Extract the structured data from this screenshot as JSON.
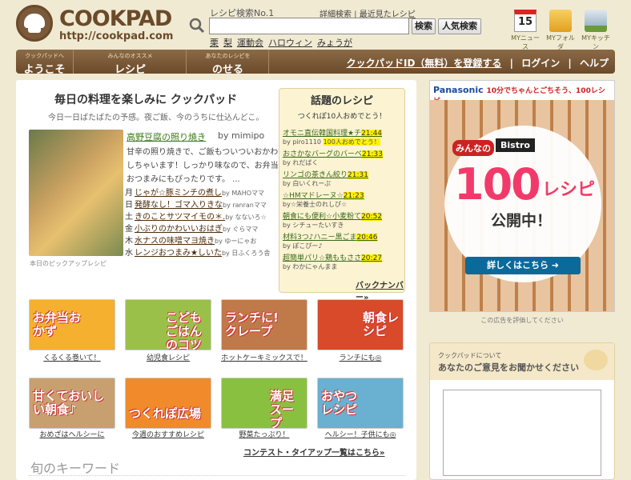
{
  "header": {
    "logo_name": "COOKPAD",
    "logo_url": "http://cookpad.com",
    "search_title": "レシピ検索No.1",
    "link_detail": "詳細検索",
    "link_recent": "最近見たレシピ",
    "search_button": "検索",
    "popular_button": "人気検索",
    "keywords": [
      "栗",
      "梨",
      "運動会",
      "ハロウィン",
      "みょうが"
    ],
    "my_icons": [
      {
        "label": "MYニュース",
        "icon": "calendar-icon",
        "num": "15"
      },
      {
        "label": "MYフォルダ",
        "icon": "folder-icon"
      },
      {
        "label": "MYキッチン",
        "icon": "kitchen-icon"
      }
    ]
  },
  "nav": {
    "tabs": [
      {
        "small": "クックパッドへ",
        "label": "ようこそ"
      },
      {
        "small": "みんなのオススメ",
        "label": "レシピ"
      },
      {
        "small": "あなたのレシピを",
        "label": "のせる"
      }
    ],
    "register": "クックパッドID（無料）を登録する",
    "login": "ログイン",
    "help": "ヘルプ",
    "sep": "|"
  },
  "main": {
    "title": "毎日の料理を楽しみに クックパッド",
    "subtitle": "今日一日ばたばたの予感。夜ご飯、今のうちに仕込んどこ。",
    "pickup": {
      "name": "高野豆腐の照り焼き",
      "by": "by mimipo",
      "desc": "甘辛の照り焼きで、ご飯もついついおかわりしちゃいます！しっかり味なので、お弁当やおつまみにもぴったりです。 ...",
      "caption": "本日のピックアップレシピ"
    },
    "week": [
      {
        "day": "月",
        "title": "じゃが☆豚ミンチの煮し",
        "by": "by MAHOママ"
      },
      {
        "day": "日",
        "title": "発酵なし！ゴマ入りきな",
        "by": "by ranranママ"
      },
      {
        "day": "土",
        "title": "きのことサツマイモの＊.",
        "by": "by なないろ☆"
      },
      {
        "day": "金",
        "title": "小ぶりのかわいいおはぎ",
        "by": "by ぐらママ"
      },
      {
        "day": "木",
        "title": "水ナスの味噌マヨ焼き",
        "by": "by ゆーにゃお"
      },
      {
        "day": "水",
        "title": "レンジおつまみ★しいた",
        "by": "by 日ふくろう舎"
      }
    ]
  },
  "wadai": {
    "title": "話題のレシピ",
    "subtitle": "つくれぽ10人おめでとう！",
    "items": [
      {
        "name": "オモニ直伝韓国料理★チ",
        "time": "21:44",
        "user": "by piro1110",
        "note": "100人おめでとう！"
      },
      {
        "name": "おさかなバーグのバーベ",
        "time": "21:33",
        "user": "by れだばく",
        "note": ""
      },
      {
        "name": "リンゴの茶きん絞り",
        "time": "21:31",
        "user": "by 白いくれーぷ",
        "note": ""
      },
      {
        "name": "☆HMマドレーヌ☆",
        "time": "21:23",
        "user": "by☆栄養士のれしぴ☆",
        "note": ""
      },
      {
        "name": "朝食にも便利☆小麦粉て",
        "time": "20:52",
        "user": "by シチューたいすき",
        "note": ""
      },
      {
        "name": "材料3つ♪ハニー黒ごま",
        "time": "20:46",
        "user": "by ぽこぴー♪",
        "note": ""
      },
      {
        "name": "超簡単パリ☆鶏ももささ",
        "time": "20:27",
        "user": "by わかにゃんまま",
        "note": ""
      }
    ],
    "back": "バックナンバー»"
  },
  "banners": [
    {
      "label": "お弁当おかず",
      "caption": "くるくる巻いて！",
      "color": "#f5b030"
    },
    {
      "label": "こどもごはんのコツ",
      "caption": "幼児食レシピ",
      "color": "#9ac04a"
    },
    {
      "label": "ランチに!クレープ",
      "caption": "ホットケーキミックスで！",
      "color": "#c07a4a"
    },
    {
      "label": "朝食レシピ",
      "caption": "ランチにも◎",
      "color": "#d84a2a"
    },
    {
      "label": "甘くておいしい朝食♪",
      "caption": "おめざはヘルシーに",
      "color": "#c8a070"
    },
    {
      "label": "つくれぽ広場",
      "caption": "今週のおすすめレシピ",
      "color": "#f08a2a"
    },
    {
      "label": "満足スープ",
      "caption": "野菜たっぷり！",
      "color": "#8ac040"
    },
    {
      "label": "おやつレシピ",
      "caption": "ヘルシー！子供にも◎",
      "color": "#6ab0d0"
    }
  ],
  "contest": "コンテスト・タイアップ一覧はこちら»",
  "keyword_head": "旬のキーワード",
  "ad": {
    "brand": "Panasonic",
    "headline": "10分でちゃんとごちそう、100レシピ。",
    "minnano": "みんなの",
    "bistro": "Bistro",
    "big": "100",
    "recipe": "レシピ",
    "open": "公開中！",
    "more": "詳しくはこちら ➜",
    "eval": "この広告を評価してください"
  },
  "opinion": {
    "small": "クックパッドについて",
    "title": "あなたのご意見をお聞かせください"
  }
}
